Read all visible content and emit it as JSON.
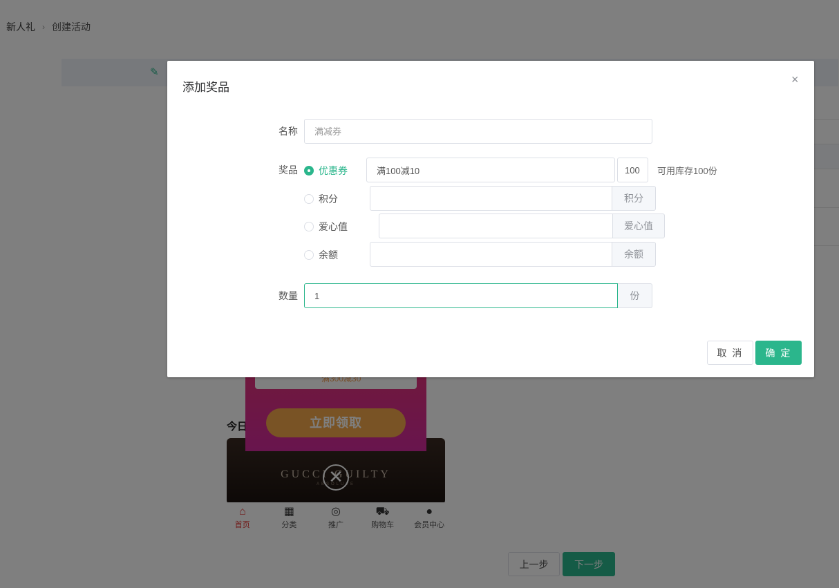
{
  "breadcrumb": {
    "items": [
      "新人礼",
      "创建活动"
    ],
    "separator": "›"
  },
  "phone_preview": {
    "title_fragment": "今日",
    "coupon_text": "满300减30",
    "claim_button": "立即领取",
    "banner_text": "GUCCI GUILTY",
    "banner_sub": "ABSOLUTE",
    "close_glyph": "✕",
    "tabs": [
      {
        "label": "首页",
        "icon": "⌂",
        "active": true
      },
      {
        "label": "分类",
        "icon": "▦",
        "active": false
      },
      {
        "label": "推广",
        "icon": "◎",
        "active": false
      },
      {
        "label": "购物车",
        "icon": "⛟",
        "active": false
      },
      {
        "label": "会员中心",
        "icon": "●",
        "active": false
      }
    ]
  },
  "footer": {
    "prev_label": "上一步",
    "next_label": "下一步"
  },
  "dialog": {
    "title": "添加奖品",
    "close_glyph": "×",
    "name_label": "名称",
    "name_placeholder": "满减券",
    "prize_label": "奖品",
    "options": {
      "coupon": {
        "label": "优惠券",
        "value": "满100减10",
        "count": "100",
        "stock_text": "可用库存100份",
        "checked": true
      },
      "points": {
        "label": "积分",
        "unit": "积分",
        "checked": false
      },
      "love": {
        "label": "爱心值",
        "unit": "爱心值",
        "checked": false
      },
      "balance": {
        "label": "余额",
        "unit": "余额",
        "checked": false
      }
    },
    "quantity_label": "数量",
    "quantity_value": "1",
    "quantity_unit": "份",
    "cancel_label": "取 消",
    "ok_label": "确 定"
  },
  "colors": {
    "accent": "#2bb68c",
    "mask": "rgba(0,0,0,0.5)"
  }
}
